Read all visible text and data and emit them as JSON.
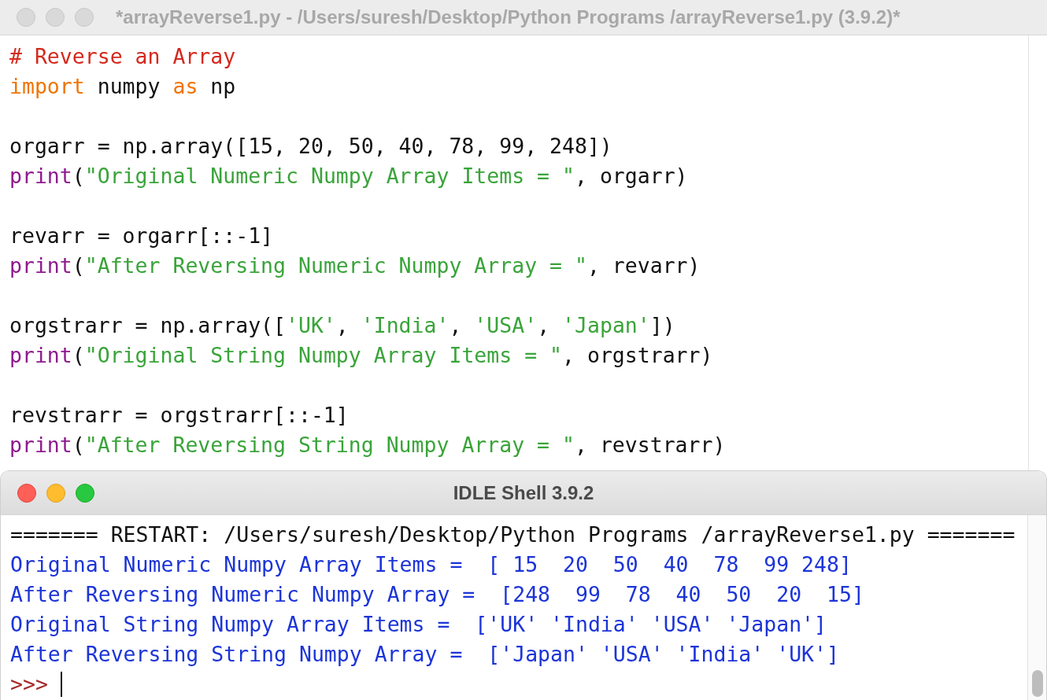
{
  "editor": {
    "title": "*arrayReverse1.py - /Users/suresh/Desktop/Python Programs /arrayReverse1.py (3.9.2)*",
    "active": false,
    "blocks": [
      {
        "lines": [
          [
            {
              "kind": "comment",
              "text": "# Reverse an Array"
            }
          ],
          [
            {
              "kind": "keyword",
              "text": "import"
            },
            {
              "kind": "plain",
              "text": " numpy "
            },
            {
              "kind": "keyword",
              "text": "as"
            },
            {
              "kind": "plain",
              "text": " np"
            }
          ]
        ]
      },
      {
        "lines": [
          [
            {
              "kind": "plain",
              "text": "orgarr = np.array([15, 20, 50, 40, 78, 99, 248])"
            }
          ],
          [
            {
              "kind": "builtin",
              "text": "print"
            },
            {
              "kind": "plain",
              "text": "("
            },
            {
              "kind": "string",
              "text": "\"Original Numeric Numpy Array Items = \""
            },
            {
              "kind": "plain",
              "text": ", orgarr)"
            }
          ]
        ]
      },
      {
        "lines": [
          [
            {
              "kind": "plain",
              "text": "revarr = orgarr[::-1]"
            }
          ],
          [
            {
              "kind": "builtin",
              "text": "print"
            },
            {
              "kind": "plain",
              "text": "("
            },
            {
              "kind": "string",
              "text": "\"After Reversing Numeric Numpy Array = \""
            },
            {
              "kind": "plain",
              "text": ", revarr)"
            }
          ]
        ]
      },
      {
        "lines": [
          [
            {
              "kind": "plain",
              "text": "orgstrarr = np.array(["
            },
            {
              "kind": "string",
              "text": "'UK'"
            },
            {
              "kind": "plain",
              "text": ", "
            },
            {
              "kind": "string",
              "text": "'India'"
            },
            {
              "kind": "plain",
              "text": ", "
            },
            {
              "kind": "string",
              "text": "'USA'"
            },
            {
              "kind": "plain",
              "text": ", "
            },
            {
              "kind": "string",
              "text": "'Japan'"
            },
            {
              "kind": "plain",
              "text": "])"
            }
          ],
          [
            {
              "kind": "builtin",
              "text": "print"
            },
            {
              "kind": "plain",
              "text": "("
            },
            {
              "kind": "string",
              "text": "\"Original String Numpy Array Items = \""
            },
            {
              "kind": "plain",
              "text": ", orgstrarr)"
            }
          ]
        ]
      },
      {
        "lines": [
          [
            {
              "kind": "plain",
              "text": "revstrarr = orgstrarr[::-1]"
            }
          ],
          [
            {
              "kind": "builtin",
              "text": "print"
            },
            {
              "kind": "plain",
              "text": "("
            },
            {
              "kind": "string",
              "text": "\"After Reversing String Numpy Array = \""
            },
            {
              "kind": "plain",
              "text": ", revstrarr)"
            }
          ]
        ]
      }
    ]
  },
  "shell": {
    "title": "IDLE Shell 3.9.2",
    "active": true,
    "lines": [
      {
        "kind": "restart",
        "text": "======= RESTART: /Users/suresh/Desktop/Python Programs /arrayReverse1.py ======="
      },
      {
        "kind": "output",
        "text": "Original Numeric Numpy Array Items =  [ 15  20  50  40  78  99 248]"
      },
      {
        "kind": "output",
        "text": "After Reversing Numeric Numpy Array =  [248  99  78  40  50  20  15]"
      },
      {
        "kind": "output",
        "text": "Original String Numpy Array Items =  ['UK' 'India' 'USA' 'Japan']"
      },
      {
        "kind": "output",
        "text": "After Reversing String Numpy Array =  ['Japan' 'USA' 'India' 'UK']"
      }
    ],
    "prompt": ">>>"
  }
}
